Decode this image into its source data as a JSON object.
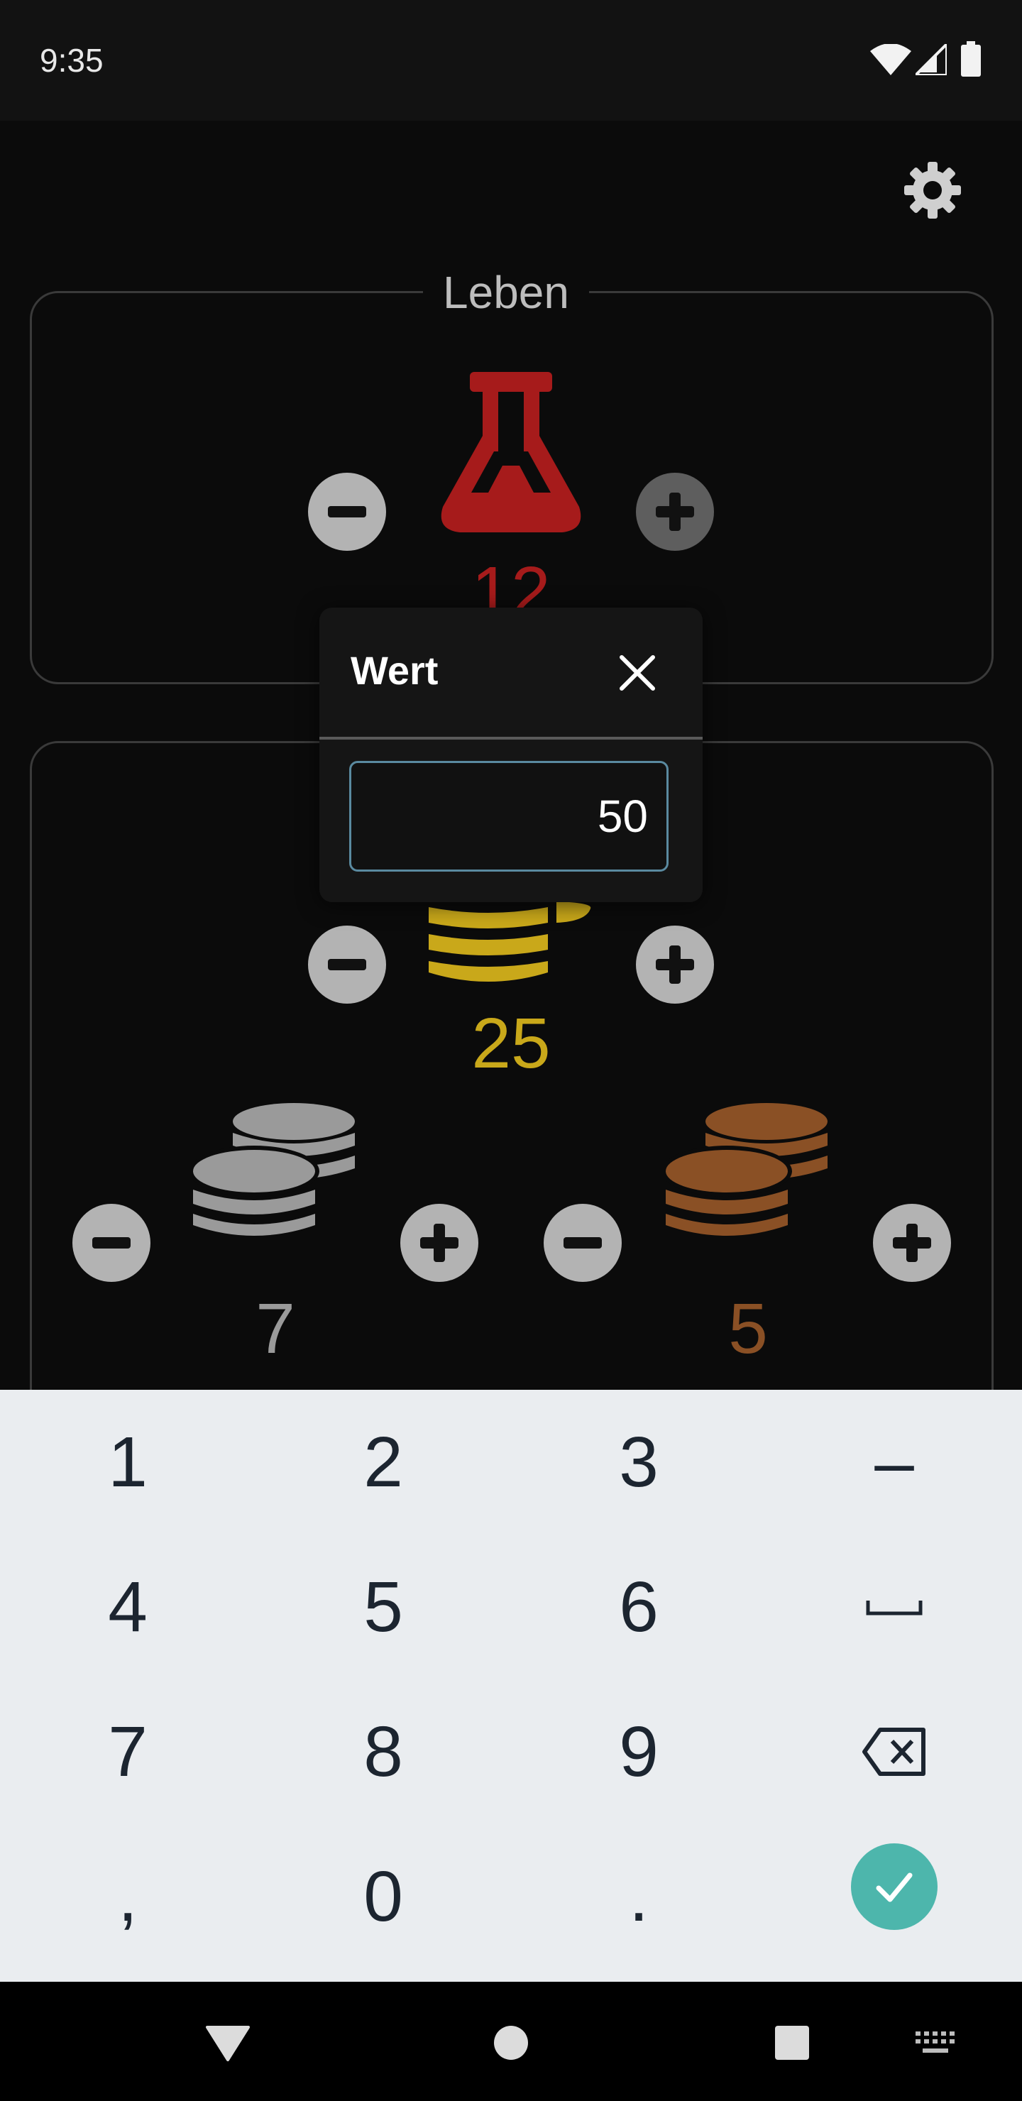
{
  "status_bar": {
    "time": "9:35"
  },
  "sections": {
    "life": {
      "title": "Leben",
      "value": "12",
      "color": "#a61b1b"
    },
    "coins": {
      "gold": {
        "value": "25",
        "color": "#c9a81a"
      },
      "silver": {
        "value": "7",
        "color": "#9a9a9a"
      },
      "copper": {
        "value": "5",
        "color": "#8a5025"
      }
    }
  },
  "dialog": {
    "title": "Wert",
    "input_value": "50"
  },
  "keyboard": {
    "keys": [
      [
        "1",
        "2",
        "3",
        "–"
      ],
      [
        "4",
        "5",
        "6",
        "␣"
      ],
      [
        "7",
        "8",
        "9",
        "⌫"
      ],
      [
        ",",
        "0",
        ".",
        "✓"
      ]
    ]
  }
}
